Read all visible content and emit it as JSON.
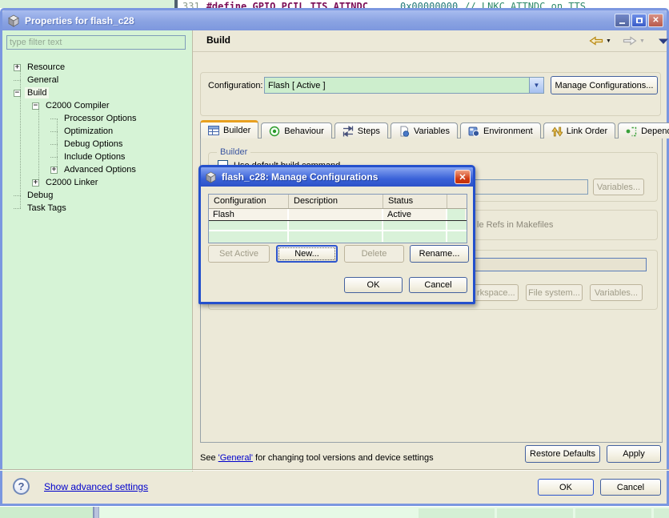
{
  "editor_strip": {
    "line_number": "331",
    "directive": "#define GPIO_PCIL_TTS_ATTNDC",
    "value": "0x00000000",
    "comment": "// LNKC ATTNDC on TTS"
  },
  "window": {
    "title": "Properties for flash_c28",
    "filter_placeholder": "type filter text",
    "tree": {
      "items": [
        {
          "label": "Resource",
          "expander": "+"
        },
        {
          "label": "General",
          "expander": ""
        },
        {
          "label": "Build",
          "expander": "−"
        },
        {
          "label": "C2000 Compiler",
          "expander": "−"
        },
        {
          "label": "Processor Options",
          "expander": ""
        },
        {
          "label": "Optimization",
          "expander": ""
        },
        {
          "label": "Debug Options",
          "expander": ""
        },
        {
          "label": "Include Options",
          "expander": ""
        },
        {
          "label": "Advanced Options",
          "expander": "+"
        },
        {
          "label": "C2000 Linker",
          "expander": "+"
        },
        {
          "label": "Debug",
          "expander": ""
        },
        {
          "label": "Task Tags",
          "expander": ""
        }
      ]
    },
    "header": {
      "title": "Build"
    },
    "config": {
      "label": "Configuration:",
      "value": "Flash  [ Active ]",
      "manage_button": "Manage Configurations..."
    },
    "tabs": [
      {
        "label": "Builder"
      },
      {
        "label": "Behaviour"
      },
      {
        "label": "Steps"
      },
      {
        "label": "Variables"
      },
      {
        "label": "Environment"
      },
      {
        "label": "Link Order"
      },
      {
        "label": "Dependencies"
      }
    ],
    "builder_tab": {
      "group_label": "Builder",
      "checkbox_label": "Use default build command",
      "variables_button": "Variables...",
      "makefiles_fragment": "le Refs in Makefiles",
      "workspace_fragment": "rkspace...",
      "file_system_button": "File system...",
      "variables_button_2": "Variables..."
    },
    "footer_note": {
      "prefix": "See ",
      "link": "'General'",
      "suffix": " for changing tool versions and device settings"
    },
    "restore_defaults_button": "Restore Defaults",
    "apply_button": "Apply",
    "advanced_link": "Show advanced settings",
    "ok_button": "OK",
    "cancel_button": "Cancel"
  },
  "modal": {
    "title": "flash_c28: Manage Configurations",
    "table": {
      "columns": [
        "Configuration",
        "Description",
        "Status"
      ],
      "rows": [
        {
          "configuration": "Flash",
          "description": "",
          "status": "Active"
        }
      ]
    },
    "set_active_button": "Set Active",
    "new_button": "New...",
    "delete_button": "Delete",
    "rename_button": "Rename...",
    "ok_button": "OK",
    "cancel_button": "Cancel"
  },
  "colors": {
    "titlebar_inactive": "#8aa3e2",
    "titlebar_active": "#3a62d8",
    "window_border": "#7b97e0",
    "modal_border": "#2450cc",
    "dialog_bg": "#ece9d8",
    "panel_green": "#d6f3d6",
    "combo_green": "#cdeecd",
    "tab_active_accent": "#e8a020",
    "link_blue": "#0000cc",
    "close_red": "#ce3912"
  }
}
